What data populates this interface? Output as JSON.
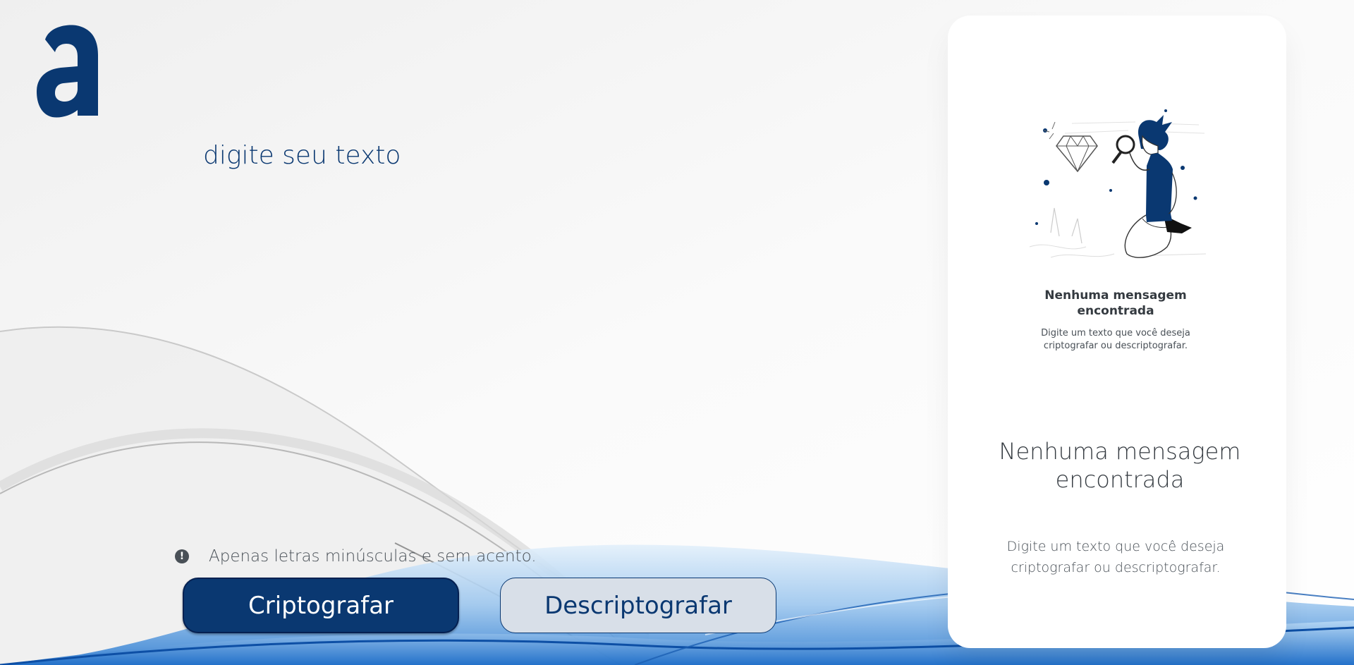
{
  "app": {
    "logo_name": "alura-logo-icon"
  },
  "editor": {
    "placeholder": "digite seu texto"
  },
  "hint": {
    "icon": "exclamation-icon",
    "text": "Apenas letras minúsculas e sem acento."
  },
  "buttons": {
    "encrypt_label": "Criptografar",
    "decrypt_label": "Descriptografar"
  },
  "result_panel": {
    "illustration_name": "person-with-magnifying-glass-illustration",
    "illustration_title": "Nenhuma mensagem encontrada",
    "illustration_text": "Digite um texto que você deseja criptografar ou descriptografar.",
    "title": "Nenhuma mensagem encontrada",
    "text": "Digite um texto que você deseja criptografar ou descriptografar."
  },
  "colors": {
    "primary": "#0a3871",
    "secondary_button_bg": "#d8dfe8",
    "background": "#f7f7f7",
    "panel": "#ffffff",
    "text_gray": "#495057"
  }
}
